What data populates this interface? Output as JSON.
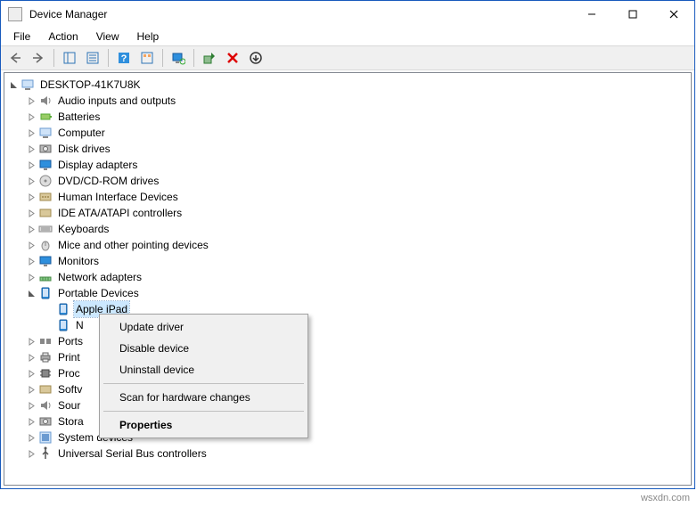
{
  "window": {
    "title": "Device Manager"
  },
  "menubar": {
    "file": "File",
    "action": "Action",
    "view": "View",
    "help": "Help"
  },
  "root_node": "DESKTOP-41K7U8K",
  "categories": [
    "Audio inputs and outputs",
    "Batteries",
    "Computer",
    "Disk drives",
    "Display adapters",
    "DVD/CD-ROM drives",
    "Human Interface Devices",
    "IDE ATA/ATAPI controllers",
    "Keyboards",
    "Mice and other pointing devices",
    "Monitors",
    "Network adapters",
    "Portable Devices"
  ],
  "portable_children": [
    "Apple iPad",
    "N"
  ],
  "after_categories": [
    "Ports",
    "Print",
    "Proc",
    "Softv",
    "Sour",
    "Stora"
  ],
  "tail_categories": [
    "System devices",
    "Universal Serial Bus controllers"
  ],
  "context_menu": {
    "update": "Update driver",
    "disable": "Disable device",
    "uninstall": "Uninstall device",
    "scan": "Scan for hardware changes",
    "properties": "Properties"
  },
  "watermark": "wsxdn.com"
}
